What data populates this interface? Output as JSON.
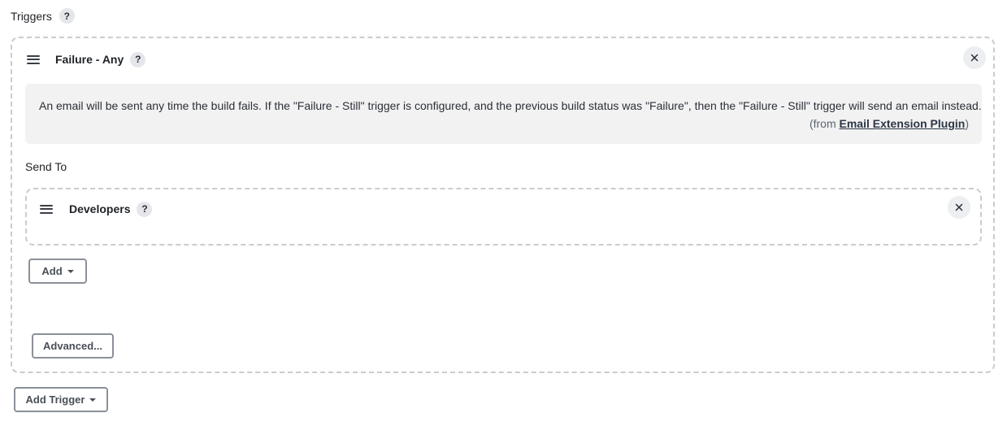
{
  "section": {
    "title": "Triggers",
    "help_label": "?"
  },
  "trigger": {
    "title": "Failure - Any",
    "help_label": "?",
    "description": "An email will be sent any time the build fails. If the \"Failure - Still\" trigger is configured, and the previous build status was \"Failure\", then the \"Failure - Still\" trigger will send an email instead.",
    "from_prefix": "(from ",
    "plugin_link": "Email Extension Plugin",
    "from_suffix": ")",
    "send_to_label": "Send To",
    "recipient": {
      "title": "Developers",
      "help_label": "?"
    },
    "add_label": "Add",
    "advanced_label": "Advanced..."
  },
  "add_trigger_label": "Add Trigger",
  "icons": {
    "drag_handle": "drag-handle-icon",
    "close": "close-icon",
    "dropdown": "caret-down-icon",
    "help": "help-icon"
  },
  "colors": {
    "info_background": "#f2f2f3",
    "dashed_border": "#c9ccd1",
    "button_border": "#8b9099"
  }
}
